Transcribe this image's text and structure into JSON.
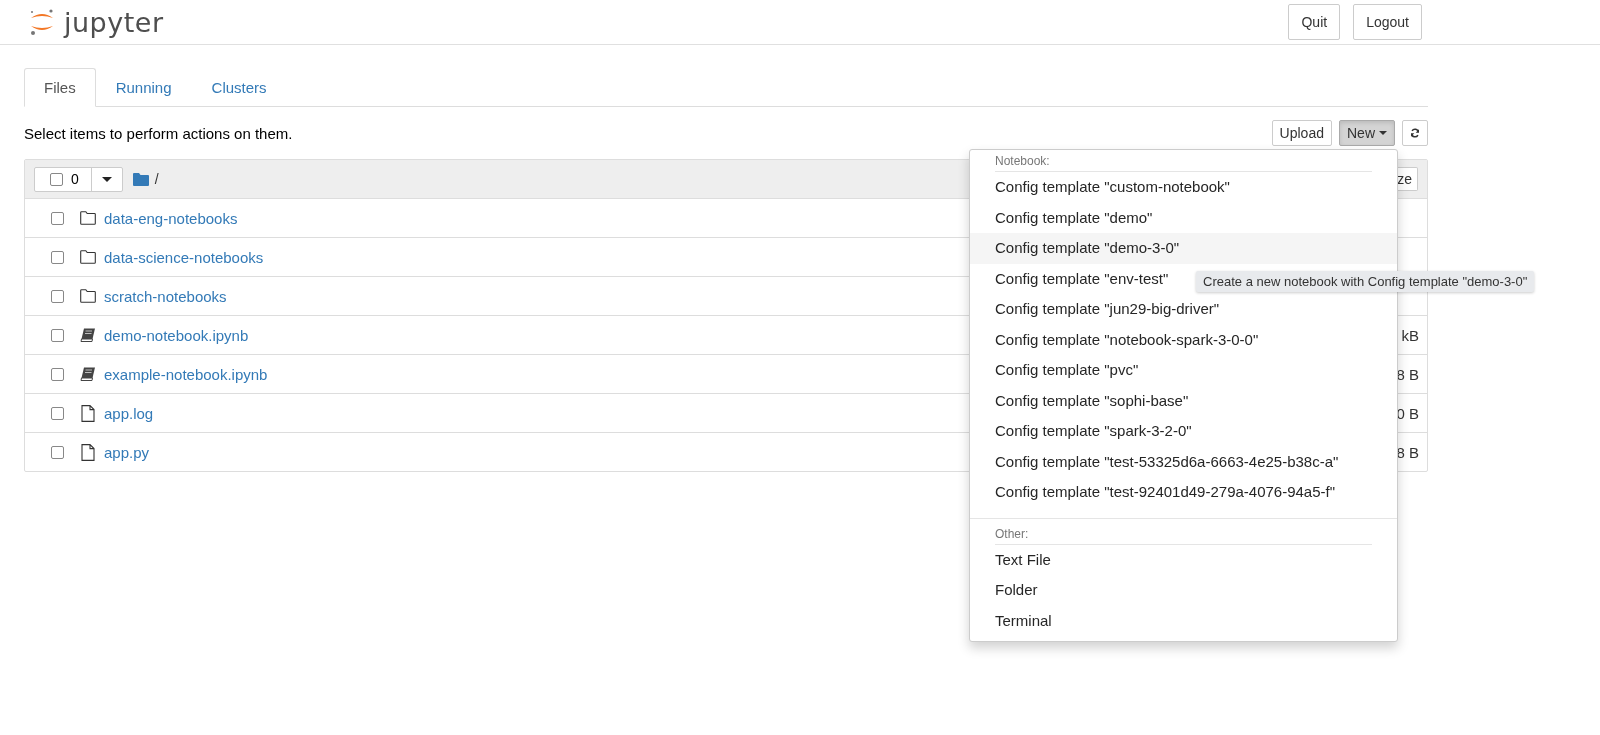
{
  "header": {
    "logo": "jupyter",
    "buttons": [
      "Quit",
      "Logout"
    ]
  },
  "tabs": [
    {
      "label": "Files",
      "selected": true
    },
    {
      "label": "Running",
      "selected": false
    },
    {
      "label": "Clusters",
      "selected": false
    }
  ],
  "toolbar": {
    "instruction": "Select items to perform actions on them.",
    "upload": "Upload",
    "new_button": {
      "label": "New",
      "expanded": true
    }
  },
  "table": {
    "header": {
      "checked": false,
      "count": "0",
      "path": "/",
      "column_3": "ze"
    },
    "rows": [
      {
        "kind": "folder",
        "name": "data-eng-notebooks",
        "checked": false
      },
      {
        "kind": "folder",
        "name": "data-science-notebooks",
        "checked": false
      },
      {
        "kind": "folder",
        "name": "scratch-notebooks",
        "checked": false
      },
      {
        "kind": "notebook",
        "name": "demo-notebook.ipynb",
        "checked": false,
        "size": "kB"
      },
      {
        "kind": "notebook",
        "name": "example-notebook.ipynb",
        "checked": false,
        "size": "8 B"
      },
      {
        "kind": "file",
        "name": "app.log",
        "checked": false,
        "size": "0 B"
      },
      {
        "kind": "file",
        "name": "app.py",
        "checked": false,
        "size": "8 B"
      }
    ]
  },
  "new_menu": {
    "sections": [
      {
        "heading": "Notebook:",
        "items": [
          {
            "label": "Config template \"custom-notebook\"",
            "highlighted": false
          },
          {
            "label": "Config template \"demo\"",
            "highlighted": false
          },
          {
            "label": "Config template \"demo-3-0\"",
            "highlighted": true
          },
          {
            "label": "Config template \"env-test\"",
            "highlighted": false
          },
          {
            "label": "Config template \"jun29-big-driver\"",
            "highlighted": false
          },
          {
            "label": "Config template \"notebook-spark-3-0-0\"",
            "highlighted": false
          },
          {
            "label": "Config template \"pvc\"",
            "highlighted": false
          },
          {
            "label": "Config template \"sophi-base\"",
            "highlighted": false
          },
          {
            "label": "Config template \"spark-3-2-0\"",
            "highlighted": false
          },
          {
            "label": "Config template \"test-53325d6a-6663-4e25-b38c-a\"",
            "highlighted": false
          },
          {
            "label": "Config template \"test-92401d49-279a-4076-94a5-f\"",
            "highlighted": false
          }
        ]
      },
      {
        "heading": "Other:",
        "items": [
          {
            "label": "Text File",
            "highlighted": false
          },
          {
            "label": "Folder",
            "highlighted": false
          },
          {
            "label": "Terminal",
            "highlighted": false
          }
        ]
      }
    ]
  },
  "tooltip": "Create a new notebook with Config template \"demo-3-0\""
}
